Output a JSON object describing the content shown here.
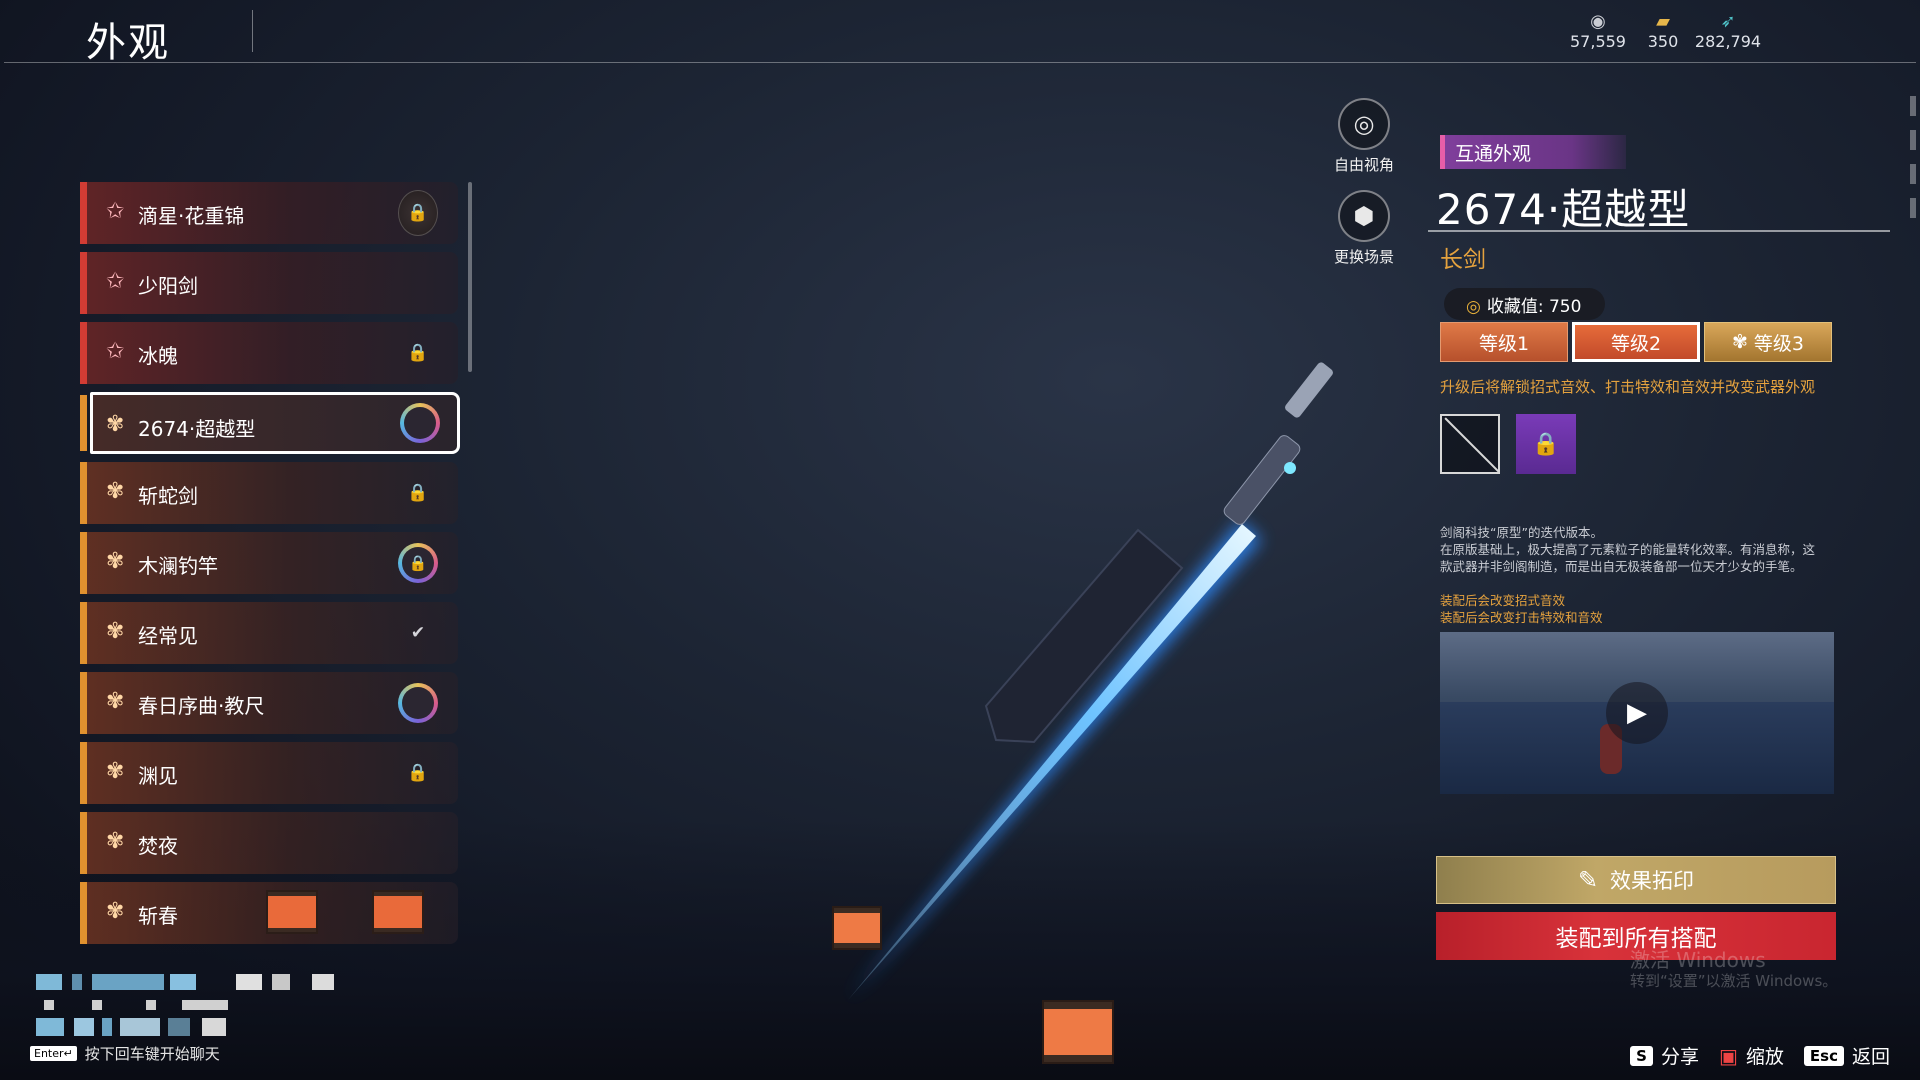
{
  "header": {
    "title": "外观",
    "currencies": [
      {
        "icon": "eye-coin-icon",
        "value": "57,559"
      },
      {
        "icon": "gold-ticket-icon",
        "value": "350"
      },
      {
        "icon": "jade-feather-icon",
        "value": "282,794"
      }
    ]
  },
  "list": {
    "items": [
      {
        "label": "滴星·花重锦",
        "rarity": "red",
        "status": "lock-disk"
      },
      {
        "label": "少阳剑",
        "rarity": "red",
        "status": ""
      },
      {
        "label": "冰魄",
        "rarity": "red",
        "status": "lock"
      },
      {
        "label": "2674·超越型",
        "rarity": "orange",
        "status": "ring",
        "selected": true
      },
      {
        "label": "斩蛇剑",
        "rarity": "orange",
        "status": "lock"
      },
      {
        "label": "木澜钓竿",
        "rarity": "orange",
        "status": "ring-lock"
      },
      {
        "label": "经常见",
        "rarity": "orange",
        "status": "check"
      },
      {
        "label": "春日序曲·教尺",
        "rarity": "orange",
        "status": "ring"
      },
      {
        "label": "渊见",
        "rarity": "orange",
        "status": "lock"
      },
      {
        "label": "焚夜",
        "rarity": "orange",
        "status": ""
      },
      {
        "label": "斩春",
        "rarity": "orange",
        "status": "lanterns"
      }
    ]
  },
  "chat": {
    "enter_key": "Enter↵",
    "hint": "按下回车键开始聊天"
  },
  "camera": {
    "free_view": "自由视角",
    "change_scene": "更换场景"
  },
  "detail": {
    "tag": "互通外观",
    "name": "2674·超越型",
    "type": "长剑",
    "collection_label": "收藏值: 750",
    "levels": [
      "等级1",
      "等级2",
      "等级3"
    ],
    "upgrade_tip": "升级后将解锁招式音效、打击特效和音效并改变武器外观",
    "desc_lines": [
      "剑阁科技“原型”的迭代版本。",
      "在原版基础上，极大提高了元素粒子的能量转化效率。有消息称，这",
      "款武器并非剑阁制造，而是出自无极装备部一位天才少女的手笔。"
    ],
    "effect_lines": [
      "装配后会改变招式音效",
      "装配后会改变打击特效和音效"
    ],
    "print_button": "效果拓印",
    "equip_button": "装配到所有搭配"
  },
  "watermark": {
    "line1": "激活 Windows",
    "line2": "转到“设置”以激活 Windows。"
  },
  "footer": {
    "share_key": "S",
    "share": "分享",
    "zoom": "缩放",
    "back_key": "Esc",
    "back": "返回"
  },
  "colors": {
    "accent_orange": "#e5a23e",
    "rarity_red": "#d23c34",
    "rarity_orange": "#e0912f",
    "equip_red": "#d8323a"
  }
}
